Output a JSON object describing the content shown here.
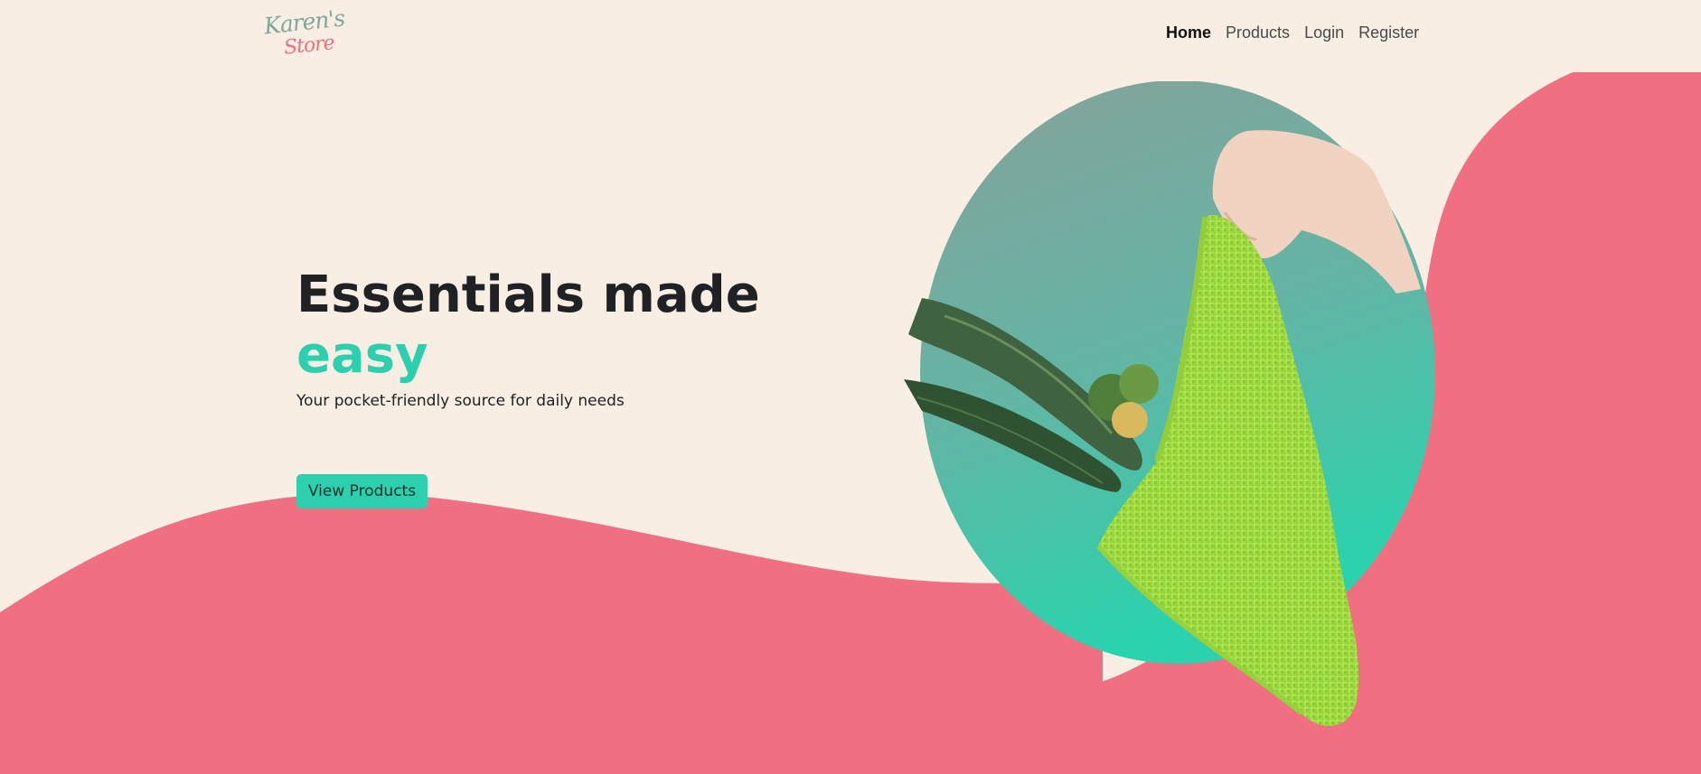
{
  "brand": {
    "logo_line1": "Karen's",
    "logo_line2": "Store"
  },
  "nav": {
    "items": [
      {
        "label": "Home",
        "active": true
      },
      {
        "label": "Products",
        "active": false
      },
      {
        "label": "Login",
        "active": false
      },
      {
        "label": "Register",
        "active": false
      }
    ]
  },
  "hero": {
    "title_line1": "Essentials made",
    "title_line2": "easy",
    "subtitle": "Your pocket-friendly source for daily needs",
    "cta_label": "View Products"
  },
  "colors": {
    "background": "#f8eee3",
    "wave": "#f06f80",
    "accent": "#2ccfae",
    "circle_top": "#87a19a",
    "circle_bottom": "#2ad3ad",
    "bag": "#a8e04a",
    "heading": "#202124"
  },
  "hero_image": {
    "icon": "grocery-bag-illustration"
  }
}
